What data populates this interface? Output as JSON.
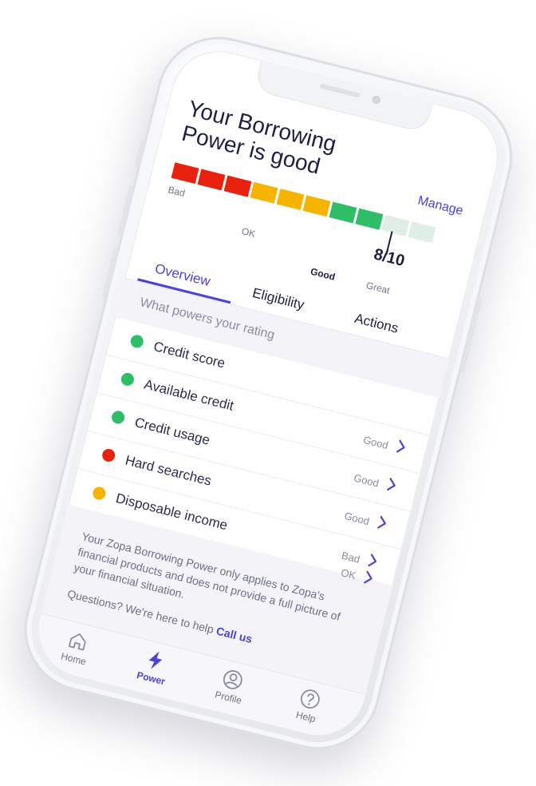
{
  "header": {
    "title": "Your Borrowing Power is good",
    "manage_label": "Manage"
  },
  "meter": {
    "score_text": "8/10",
    "score_value": 8,
    "score_max": 10,
    "levels": [
      "Bad",
      "OK",
      "Good",
      "Great"
    ],
    "segment_colors": [
      "#e8220e",
      "#e8220e",
      "#e8220e",
      "#f6b400",
      "#f6b400",
      "#f6b400",
      "#2dbe67",
      "#2dbe67",
      "#e0efe6",
      "#e0efe6"
    ]
  },
  "tabs": [
    {
      "label": "Overview",
      "active": true
    },
    {
      "label": "Eligibility",
      "active": false
    },
    {
      "label": "Actions",
      "active": false
    }
  ],
  "section_heading": "What powers your rating",
  "factors": [
    {
      "label": "Credit score",
      "status": "",
      "color": "#2dbe67"
    },
    {
      "label": "Available credit",
      "status": "Good",
      "color": "#2dbe67"
    },
    {
      "label": "Credit usage",
      "status": "Good",
      "color": "#2dbe67"
    },
    {
      "label": "Hard searches",
      "status": "Good",
      "color": "#e8220e"
    },
    {
      "label": "Disposable income",
      "status": "Bad",
      "color": "#f6b400"
    }
  ],
  "extra_status": "OK",
  "footer": {
    "disclaimer": "Your Zopa Borrowing Power only applies to Zopa's financial products and does not provide a full picture of your financial situation.",
    "help_text": "Questions? We're here to help ",
    "call_label": "Call us"
  },
  "nav": [
    {
      "label": "Home",
      "icon": "home-icon",
      "active": false
    },
    {
      "label": "Power",
      "icon": "lightning-icon",
      "active": true
    },
    {
      "label": "Profile",
      "icon": "profile-icon",
      "active": false
    },
    {
      "label": "Help",
      "icon": "help-icon",
      "active": false
    }
  ],
  "colors": {
    "accent": "#4a44d6",
    "text": "#1e1e46"
  }
}
